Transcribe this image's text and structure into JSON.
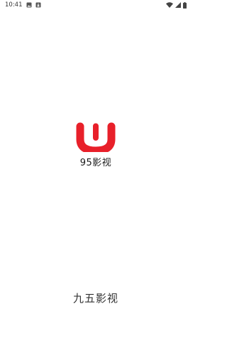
{
  "status_bar": {
    "time": "10:41",
    "icons": [
      "image-icon",
      "download-icon",
      "wifi-icon",
      "cellular-signal-icon",
      "battery-icon"
    ]
  },
  "splash": {
    "logo_text": "95影视",
    "app_name": "九五影视",
    "brand_color": "#e8202a"
  }
}
